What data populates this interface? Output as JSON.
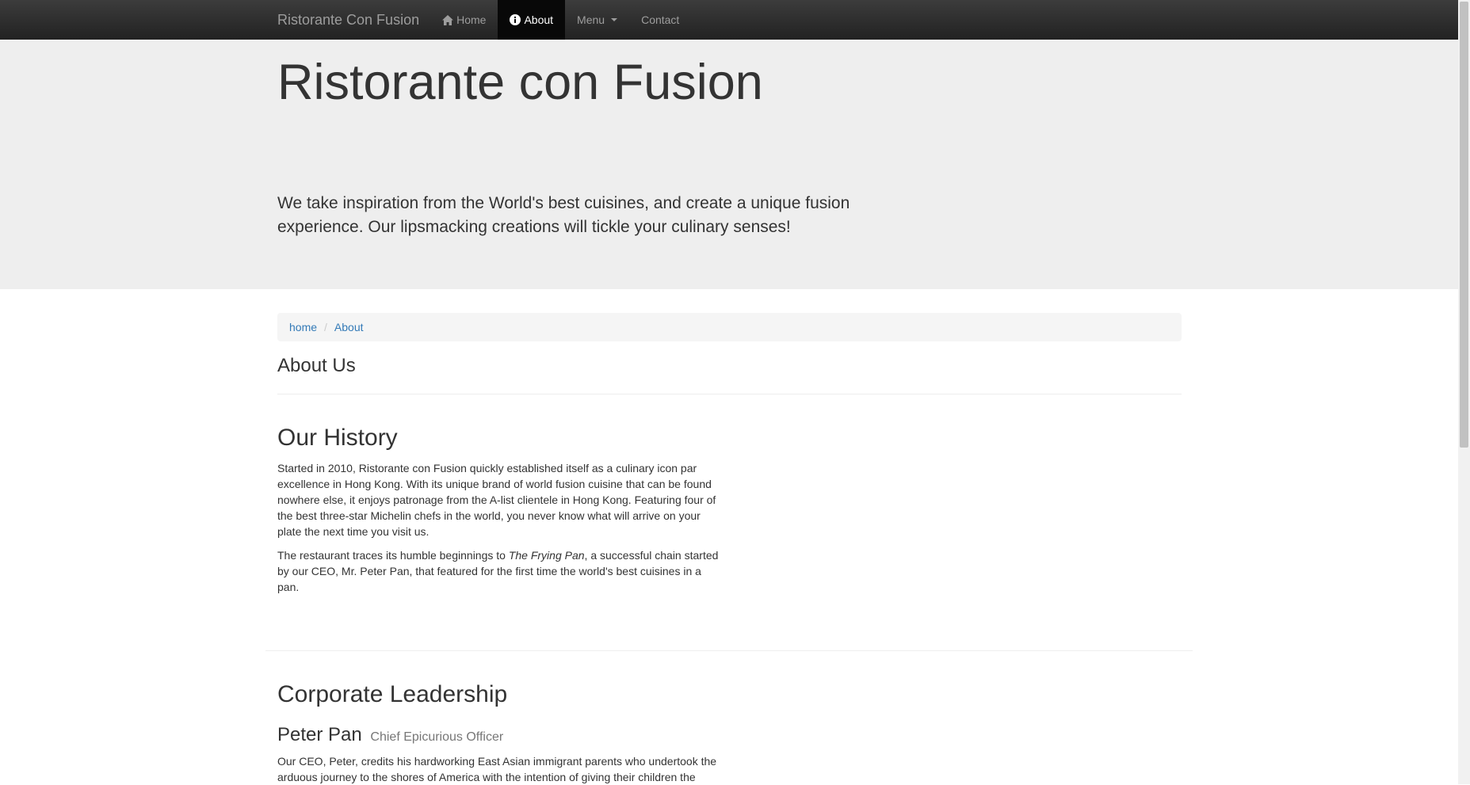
{
  "navbar": {
    "brand": "Ristorante Con Fusion",
    "items": [
      {
        "label": "Home",
        "icon": "home-icon"
      },
      {
        "label": "About",
        "icon": "info-icon",
        "active": true
      },
      {
        "label": "Menu",
        "icon": "caret-down-icon"
      },
      {
        "label": "Contact"
      }
    ]
  },
  "jumbotron": {
    "title": "Ristorante con Fusion",
    "text": "We take inspiration from the World's best cuisines, and create a unique fusion experience. Our lipsmacking creations will tickle your culinary senses!"
  },
  "breadcrumb": {
    "items": [
      "home",
      "About"
    ]
  },
  "about": {
    "heading": "About Us",
    "history_heading": "Our History",
    "history_p1": "Started in 2010, Ristorante con Fusion quickly established itself as a culinary icon par excellence in Hong Kong. With its unique brand of world fusion cuisine that can be found nowhere else, it enjoys patronage from the A-list clientele in Hong Kong. Featuring four of the best three-star Michelin chefs in the world, you never know what will arrive on your plate the next time you visit us.",
    "history_p2_before": "The restaurant traces its humble beginnings to ",
    "history_p2_em": "The Frying Pan",
    "history_p2_after": ", a successful chain started by our CEO, Mr. Peter Pan, that featured for the first time the world's best cuisines in a pan.",
    "leadership_heading": "Corporate Leadership",
    "leader_name": "Peter Pan",
    "leader_title": "Chief Epicurious Officer",
    "leader_bio": "Our CEO, Peter, credits his hardworking East Asian immigrant parents who undertook the arduous journey to the shores of America with the intention of giving their children the"
  },
  "colors": {
    "navbar_bg": "#222222",
    "jumbotron_bg": "#eeeeee",
    "link": "#337ab7"
  }
}
